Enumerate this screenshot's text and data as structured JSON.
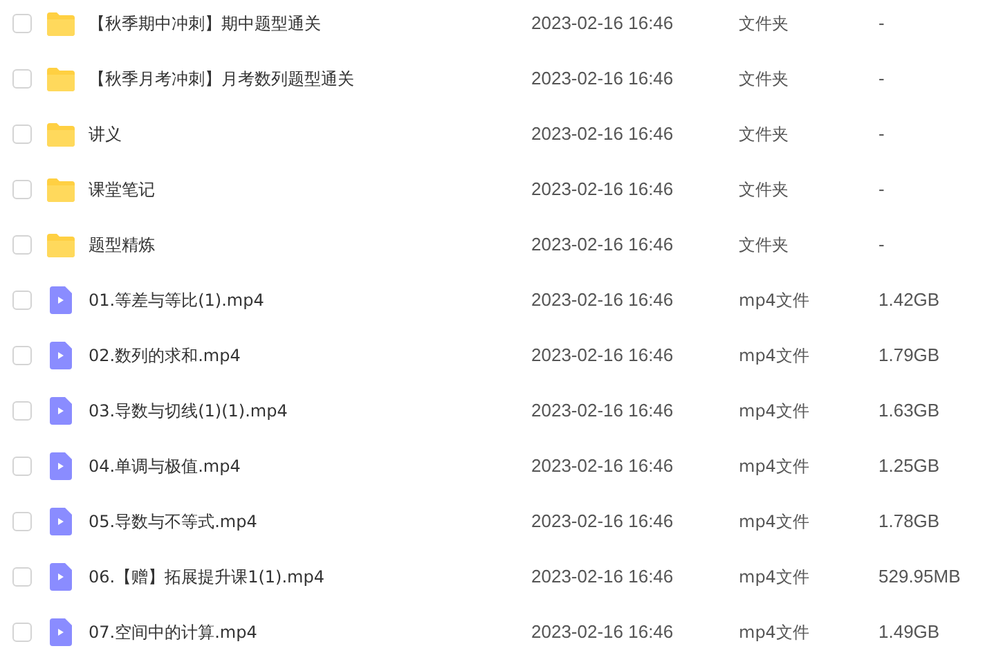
{
  "files": [
    {
      "kind": "folder",
      "checked": false,
      "name": "【秋季期中冲刺】期中题型通关",
      "modified": "2023-02-16 16:46",
      "type": "文件夹",
      "size": "-"
    },
    {
      "kind": "folder",
      "checked": false,
      "name": "【秋季月考冲刺】月考数列题型通关",
      "modified": "2023-02-16 16:46",
      "type": "文件夹",
      "size": "-"
    },
    {
      "kind": "folder",
      "checked": false,
      "name": "讲义",
      "modified": "2023-02-16 16:46",
      "type": "文件夹",
      "size": "-"
    },
    {
      "kind": "folder",
      "checked": false,
      "name": "课堂笔记",
      "modified": "2023-02-16 16:46",
      "type": "文件夹",
      "size": "-"
    },
    {
      "kind": "folder",
      "checked": false,
      "name": "题型精炼",
      "modified": "2023-02-16 16:46",
      "type": "文件夹",
      "size": "-"
    },
    {
      "kind": "video",
      "checked": false,
      "name": "01.等差与等比(1).mp4",
      "modified": "2023-02-16 16:46",
      "type": "mp4文件",
      "size": "1.42GB"
    },
    {
      "kind": "video",
      "checked": false,
      "name": "02.数列的求和.mp4",
      "modified": "2023-02-16 16:46",
      "type": "mp4文件",
      "size": "1.79GB"
    },
    {
      "kind": "video",
      "checked": false,
      "name": "03.导数与切线(1)(1).mp4",
      "modified": "2023-02-16 16:46",
      "type": "mp4文件",
      "size": "1.63GB"
    },
    {
      "kind": "video",
      "checked": false,
      "name": "04.单调与极值.mp4",
      "modified": "2023-02-16 16:46",
      "type": "mp4文件",
      "size": "1.25GB"
    },
    {
      "kind": "video",
      "checked": false,
      "name": "05.导数与不等式.mp4",
      "modified": "2023-02-16 16:46",
      "type": "mp4文件",
      "size": "1.78GB"
    },
    {
      "kind": "video",
      "checked": false,
      "name": "06.【赠】拓展提升课1(1).mp4",
      "modified": "2023-02-16 16:46",
      "type": "mp4文件",
      "size": "529.95MB"
    },
    {
      "kind": "video",
      "checked": false,
      "name": "07.空间中的计算.mp4",
      "modified": "2023-02-16 16:46",
      "type": "mp4文件",
      "size": "1.49GB"
    }
  ]
}
